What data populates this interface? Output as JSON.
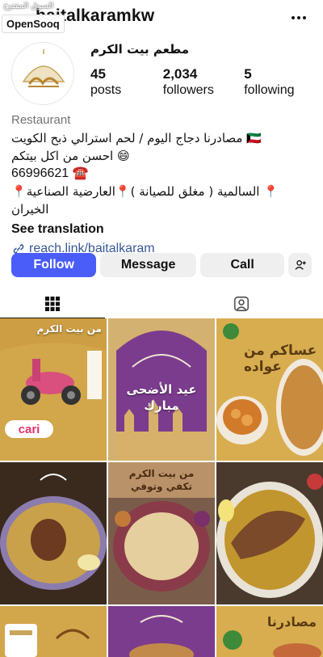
{
  "watermark": {
    "arabic": "السوق المفتوح",
    "brand": "OpenSooq"
  },
  "header": {
    "username": "baitalkaramkw",
    "more_icon": "more-horizontal-icon"
  },
  "profile": {
    "display_name": "مطعم بيت الكرم",
    "stats": [
      {
        "value": "45",
        "label": "posts"
      },
      {
        "value": "2,034",
        "label": "followers"
      },
      {
        "value": "5",
        "label": "following"
      }
    ]
  },
  "bio": {
    "category": "Restaurant",
    "lines": [
      "مصادرنا دجاج اليوم / لحم استرالي ذبح الكويت 🇰🇼",
      "احسن من اكل بيتكم 😄",
      "66996621 ☎️",
      "📍السالمية ( مغلق للصيانة )📍العارضية الصناعية 📍",
      "الخيران"
    ],
    "see_translation": "See translation",
    "link": "reach.link/baitalkaram"
  },
  "actions": {
    "follow": "Follow",
    "message": "Message",
    "call": "Call",
    "add_user_icon": "add-user-icon"
  },
  "tabs": {
    "grid_icon": "grid-icon",
    "tagged_icon": "tagged-icon"
  },
  "posts": [
    {
      "caption": "من بيت الكرم",
      "theme": "gold"
    },
    {
      "caption": "عيد الأضحى مبارك",
      "theme": "purple"
    },
    {
      "caption": "عساكم من عواده",
      "theme": "gold"
    },
    {
      "caption": "",
      "theme": "food"
    },
    {
      "caption": "من بيت الكرم تكفي وتوفي",
      "theme": "food"
    },
    {
      "caption": "",
      "theme": "food"
    },
    {
      "caption": "",
      "theme": "gold"
    },
    {
      "caption": "",
      "theme": "purple"
    },
    {
      "caption": "مصادرنا",
      "theme": "gold"
    }
  ],
  "colors": {
    "follow_button": "#4a5df9",
    "secondary_button": "#efefef",
    "link": "#385898",
    "category": "#737373"
  }
}
